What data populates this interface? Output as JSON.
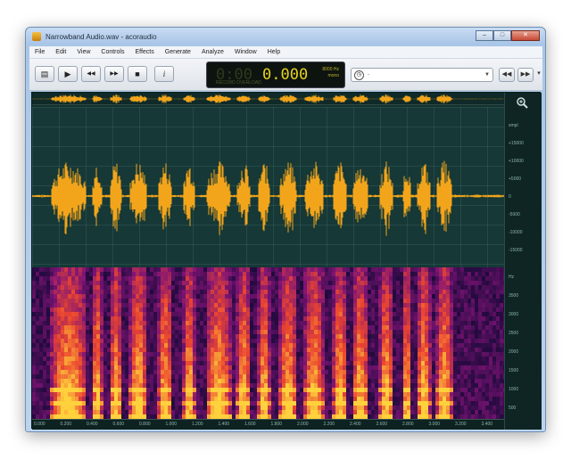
{
  "window": {
    "title": "Narrowband Audio.wav - acoraudio",
    "controls": {
      "minimize": "–",
      "maximize": "□",
      "close": "✕"
    }
  },
  "menu": [
    "File",
    "Edit",
    "View",
    "Controls",
    "Effects",
    "Generate",
    "Analyze",
    "Window",
    "Help"
  ],
  "toolbar": {
    "buttons": [
      {
        "name": "view-toggle-button",
        "icon": "▤"
      },
      {
        "name": "play-button",
        "icon": "▶"
      },
      {
        "name": "rewind-button",
        "icon": "◀◀"
      },
      {
        "name": "fast-forward-button",
        "icon": "▶▶"
      },
      {
        "name": "stop-button",
        "icon": "■"
      },
      {
        "name": "info-button",
        "icon": "i"
      }
    ],
    "time_display": {
      "ghost": "0:00",
      "value": "0.000",
      "side_line1": "8000 Hz",
      "side_line2": "mono",
      "sub": "RECORD   OVERLOAD"
    },
    "position_field": {
      "icon": "clock-icon",
      "value": "-"
    },
    "nav": {
      "back": "◀◀",
      "forward": "▶▶",
      "more": "▾"
    }
  },
  "editor": {
    "amplitude_scale": [
      "smpl",
      "+15000",
      "+10000",
      "+5000",
      "0",
      "-5000",
      "-10000",
      "-15000"
    ],
    "frequency_scale": [
      "Hz",
      "3500",
      "3000",
      "2500",
      "2000",
      "1500",
      "1000",
      "500"
    ],
    "time_ruler": [
      "0.000",
      "0.200",
      "0.400",
      "0.600",
      "0.800",
      "1.000",
      "1.200",
      "1.400",
      "1.600",
      "1.800",
      "2.000",
      "2.200",
      "2.400",
      "2.600",
      "2.800",
      "3.000",
      "3.200",
      "3.400"
    ],
    "colors": {
      "waveform": "#f2a51b",
      "background": "#163836",
      "spectrogram_low": "#1a0a3a",
      "spectrogram_high": "#ffd23c"
    }
  }
}
